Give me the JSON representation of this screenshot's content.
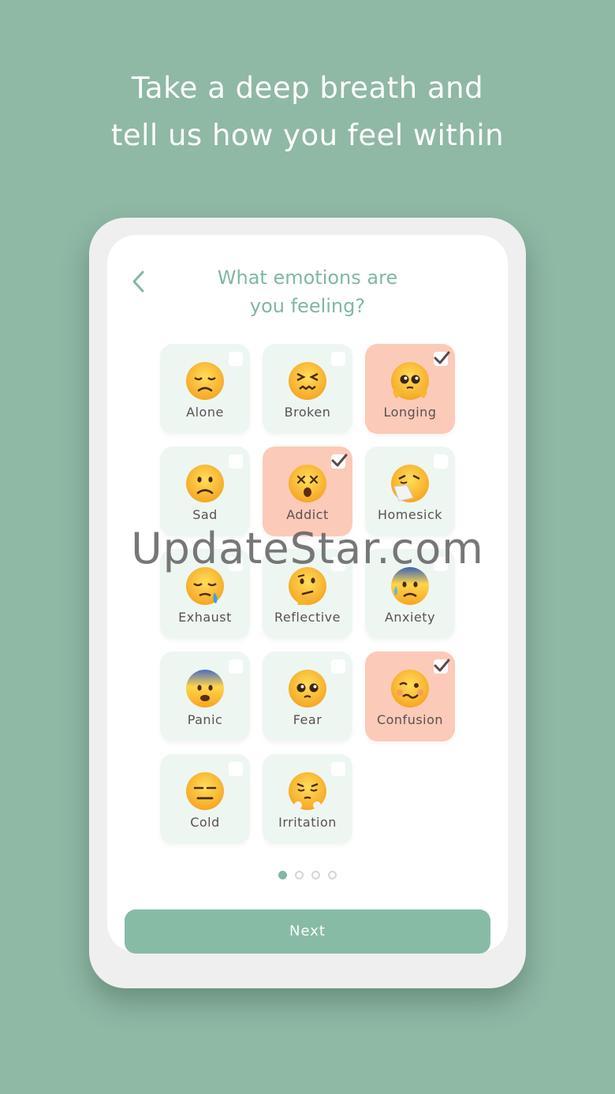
{
  "headline": {
    "line1": "Take a deep breath and",
    "line2": "tell us how you feel within"
  },
  "screen": {
    "back_icon": "chevron-left-icon",
    "question_line1": "What emotions are",
    "question_line2": "you feeling?",
    "emotions": [
      {
        "label": "Alone",
        "icon": "disappointed-face",
        "selected": false
      },
      {
        "label": "Broken",
        "icon": "confounded-face",
        "selected": false
      },
      {
        "label": "Longing",
        "icon": "face-holding-back-tears",
        "selected": true
      },
      {
        "label": "Sad",
        "icon": "slightly-frowning-face",
        "selected": false
      },
      {
        "label": "Addict",
        "icon": "dizzy-face",
        "selected": true
      },
      {
        "label": "Homesick",
        "icon": "sneezing-face",
        "selected": false
      },
      {
        "label": "Exhaust",
        "icon": "sleepy-face",
        "selected": false
      },
      {
        "label": "Reflective",
        "icon": "thinking-face",
        "selected": false
      },
      {
        "label": "Anxiety",
        "icon": "anxious-face-with-sweat",
        "selected": false
      },
      {
        "label": "Panic",
        "icon": "fearful-face",
        "selected": false
      },
      {
        "label": "Fear",
        "icon": "pleading-face",
        "selected": false
      },
      {
        "label": "Confusion",
        "icon": "woozy-face",
        "selected": true
      },
      {
        "label": "Cold",
        "icon": "expressionless-face",
        "selected": false
      },
      {
        "label": "Irritation",
        "icon": "face-with-steam",
        "selected": false
      }
    ],
    "pagination": {
      "total": 4,
      "current": 1
    },
    "next_label": "Next"
  },
  "watermark": "UpdateStar.com",
  "colors": {
    "background": "#8fb8a5",
    "accent": "#86b6a2",
    "selected_card": "#fccab8",
    "card": "#eef6f2"
  }
}
